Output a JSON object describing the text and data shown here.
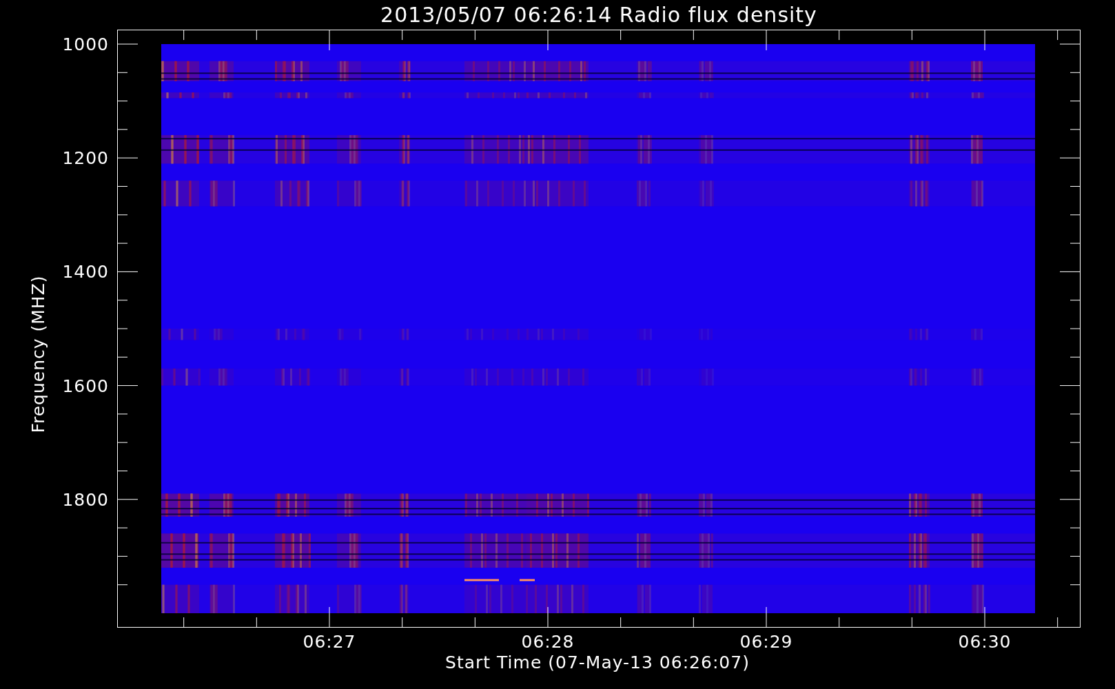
{
  "title": "2013/05/07 06:26:14 Radio flux density",
  "y_axis": {
    "label": "Frequency (MHZ)",
    "ticks": [
      "1000",
      "1200",
      "1400",
      "1600",
      "1800"
    ]
  },
  "x_axis": {
    "label": "Start Time (07-May-13 06:26:07)",
    "ticks": [
      "06:27",
      "06:28",
      "06:29",
      "06:30"
    ]
  }
}
